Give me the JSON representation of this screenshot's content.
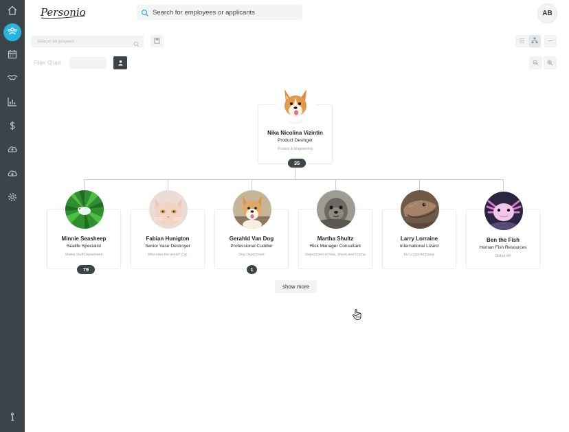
{
  "app": {
    "logo_text": "Personio",
    "user_initials": "AB"
  },
  "sidebar": {
    "items": [
      {
        "icon": "home-icon"
      },
      {
        "icon": "people-icon",
        "active": true,
        "accent": "#28b4e0"
      },
      {
        "icon": "calendar-icon"
      },
      {
        "icon": "handshake-icon"
      },
      {
        "icon": "bar-chart-icon"
      },
      {
        "icon": "dollar-icon"
      },
      {
        "icon": "cloud-upload-icon"
      },
      {
        "icon": "cloud-download-icon"
      },
      {
        "icon": "gear-icon"
      },
      {
        "icon": "info-icon"
      }
    ]
  },
  "header": {
    "search_placeholder": "Search for employees or applicants"
  },
  "toolbar": {
    "search_employees_placeholder": "Search employees",
    "filter_label": "Filter Chart"
  },
  "org": {
    "root": {
      "name": "Nika Nicolina Vizintin",
      "role": "Product Desinger",
      "department": "Product & Engineering",
      "reports_count": "35"
    },
    "children": [
      {
        "name": "Minnie Seasheep",
        "role": "Sealife Specialist",
        "department": "Sheep Stuff Department",
        "reports_count": "79"
      },
      {
        "name": "Fabian Hunigton",
        "role": "Senior Vase Destroyer",
        "department": "Who rules the world? Cat.",
        "reports_count": ""
      },
      {
        "name": "Gerahld Van Dog",
        "role": "Professional Cuddler",
        "department": "Dog Department",
        "reports_count": "1"
      },
      {
        "name": "Martha Shultz",
        "role": "Risk Manager Consultant",
        "department": "Department of Risk, Shock and Drama",
        "reports_count": ""
      },
      {
        "name": "Larry Lorraine",
        "role": "International Lizard",
        "department": "EU Lizard Ambassy",
        "reports_count": ""
      },
      {
        "name": "Ben the Fish",
        "role": "Human Fish Resources",
        "department": "Global HR",
        "reports_count": ""
      }
    ],
    "show_more_label": "show more"
  },
  "colors": {
    "sidebar_bg": "#3d4449",
    "accent": "#28b4e0",
    "badge_bg": "#3d4449"
  }
}
